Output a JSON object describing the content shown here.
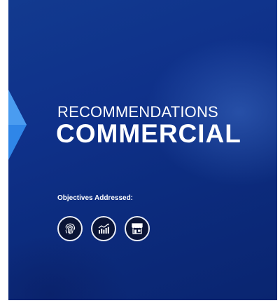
{
  "slide": {
    "subtitle": "RECOMMENDATIONS",
    "title": "COMMERCIAL",
    "objectives_label": "Objectives Addressed:",
    "objective_icons": [
      "fingerprint-icon",
      "growth-chart-icon",
      "storefront-icon"
    ]
  },
  "colors": {
    "background": "#0f318a",
    "accent_arrow": "#2f86e8",
    "text": "#ffffff",
    "icon_fill": "#0a1436"
  }
}
